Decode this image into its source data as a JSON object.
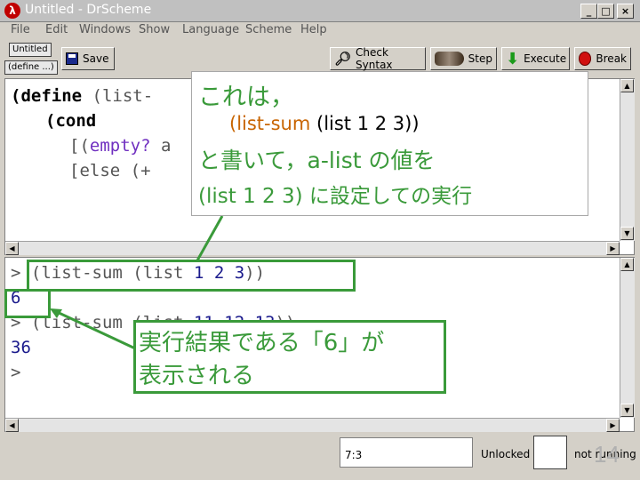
{
  "window": {
    "title": "Untitled - DrScheme",
    "controls": [
      "_",
      "□",
      "×"
    ]
  },
  "menu": [
    "File",
    "Edit",
    "Windows",
    "Show",
    "Language",
    "Scheme",
    "Help"
  ],
  "toolbar": {
    "file_name": "Untitled",
    "define_menu": "(define ...)",
    "save": "Save",
    "check_syntax": "Check Syntax",
    "step": "Step",
    "execute": "Execute",
    "break": "Break"
  },
  "definitions": {
    "line1_kw": "(define",
    "line1_rest": "(list-",
    "line2_kw": "(cond",
    "line3_a": "[(",
    "line3_b": "empty?",
    "line3_c": " a",
    "line4": "[else (+"
  },
  "interactions": {
    "prompt": ">",
    "expr1_open": "(list-sum (list ",
    "expr1_nums": "1 2 3",
    "expr1_close": "))",
    "result1": "6",
    "expr2_open": "(list-sum (list ",
    "expr2_nums": "11 12 13",
    "expr2_close": "))",
    "result2": "36"
  },
  "callouts": {
    "top_line1": "これは，",
    "top_line2_call": "(list-sum",
    "top_line2_rest": " (list 1 2 3))",
    "top_line3_a": "と書いて，a-list の値を",
    "top_line4": "(list 1 2 3) に設定しての実行",
    "bottom_line1": "実行結果である「6」が",
    "bottom_line2": "表示される"
  },
  "status": {
    "position": "7:3",
    "lock": "Unlocked",
    "running": "not running"
  },
  "page_number": "14",
  "colors": {
    "accent_green": "#3a9a3a",
    "result_blue": "#1a1a8c",
    "paren_gray": "#555555",
    "keyword": "#000000",
    "orange_call": "#c86400",
    "teal_text": "#1f6f6f"
  }
}
